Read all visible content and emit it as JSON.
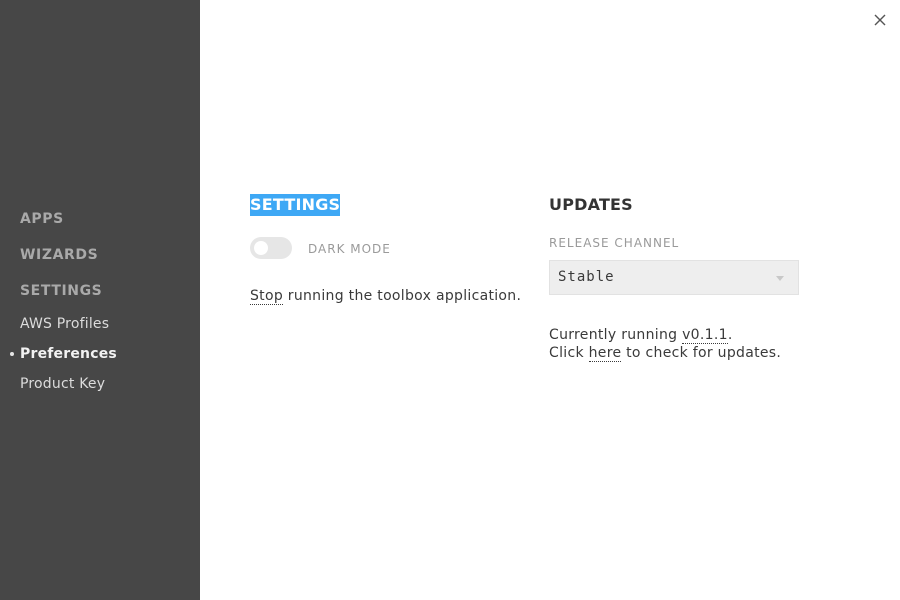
{
  "sidebar": {
    "sections": [
      {
        "label": "APPS"
      },
      {
        "label": "WIZARDS"
      },
      {
        "label": "SETTINGS"
      }
    ],
    "items": [
      {
        "label": "AWS Profiles"
      },
      {
        "label": "Preferences",
        "active": true
      },
      {
        "label": "Product Key"
      }
    ]
  },
  "close": {
    "icon": "close-icon"
  },
  "settings": {
    "heading": "SETTINGS",
    "dark_mode_label": "DARK MODE",
    "dark_mode_on": false,
    "stop_link": "Stop",
    "stop_text": " running the toolbox application."
  },
  "updates": {
    "heading": "UPDATES",
    "release_channel_label": "RELEASE CHANNEL",
    "release_channel_value": "Stable",
    "running_prefix": "Currently running ",
    "version": "v0.1.1",
    "running_suffix": ".",
    "click_prefix": "Click ",
    "here_link": "here",
    "click_suffix": " to check for updates."
  },
  "colors": {
    "sidebar_bg": "#474747",
    "selection": "#3ea8f5"
  }
}
